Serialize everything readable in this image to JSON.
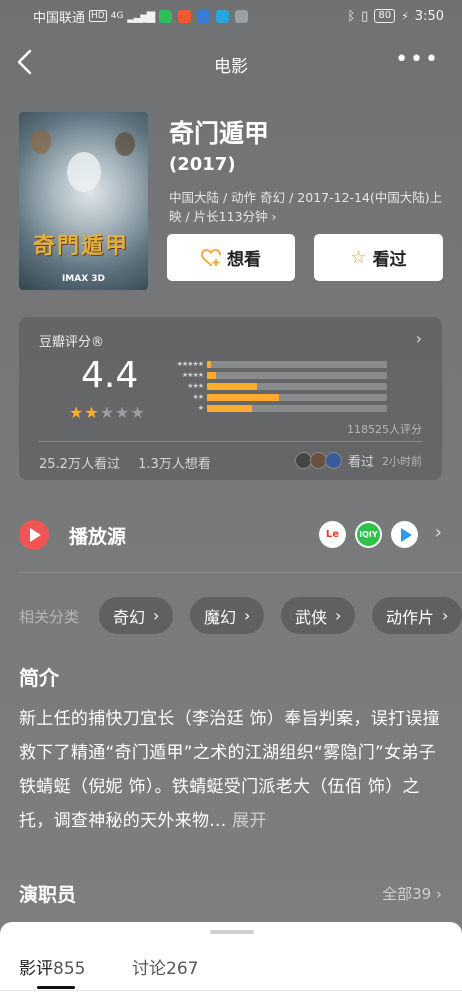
{
  "status_bar": {
    "carrier": "中国联通",
    "network_badge": "HD",
    "signal_label": "4G",
    "battery": "80",
    "time": "3:50"
  },
  "nav": {
    "title": "电影",
    "more_label": "•••"
  },
  "movie": {
    "poster_title": "奇門遁甲",
    "poster_format": "IMAX 3D",
    "title": "奇门遁甲",
    "year": "(2017)",
    "meta": "中国大陆 / 动作 奇幻 / 2017-12-14(中国大陆)上映 / 片长113分钟 ›",
    "want_label": "想看",
    "seen_label": "看过"
  },
  "rating": {
    "label": "豆瓣评分®",
    "score": "4.4",
    "stars_filled": 2,
    "stars_total": 5,
    "distribution": [
      {
        "stars": "★★★★★",
        "fraction": 0.02
      },
      {
        "stars": "★★★★",
        "fraction": 0.05
      },
      {
        "stars": "★★★",
        "fraction": 0.28
      },
      {
        "stars": "★★",
        "fraction": 0.4
      },
      {
        "stars": "★",
        "fraction": 0.25
      }
    ],
    "count": "118525人评分",
    "seen_count": "25.2万人看过",
    "want_count": "1.3万人想看",
    "recent_label": "看过",
    "recent_time": "2小时前"
  },
  "play": {
    "label": "播放源",
    "sources": [
      "乐视视频",
      "爱奇艺",
      "腾讯视频"
    ]
  },
  "categories": {
    "label": "相关分类",
    "items": [
      "奇幻",
      "魔幻",
      "武侠",
      "动作片"
    ]
  },
  "intro": {
    "heading": "简介",
    "text": "新上任的捕快刀宜长（李治廷 饰）奉旨判案，误打误撞救下了精通“奇门遁甲”之术的江湖组织“雾隐门”女弟子铁蜻蜓（倪妮 饰）。铁蜻蜓受门派老大（伍佰 饰）之托，调查神秘的天外来物...",
    "more": "展开"
  },
  "cast": {
    "heading": "演职员",
    "all_label": "全部39 ›"
  },
  "sheet": {
    "tabs": [
      {
        "label": "影评",
        "count": "855"
      },
      {
        "label": "讨论",
        "count": "267"
      }
    ]
  },
  "colors": {
    "accent_orange": "#ffac2d",
    "play_red": "#f05454",
    "background": "#767879"
  }
}
